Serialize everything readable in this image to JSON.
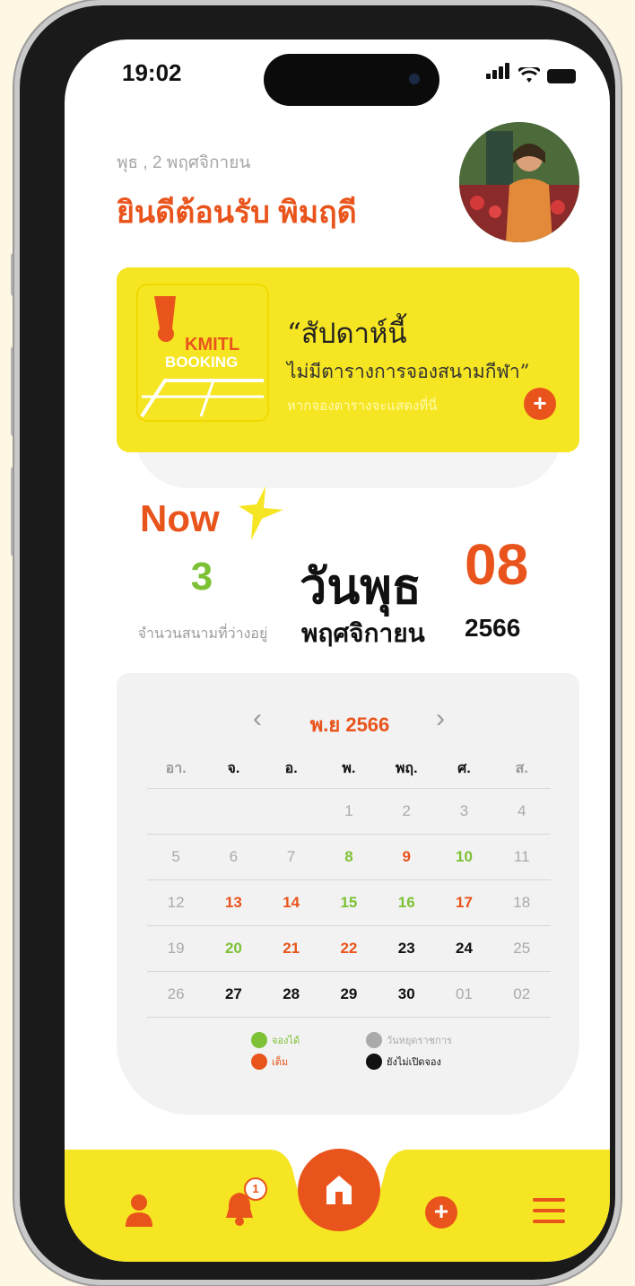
{
  "status": {
    "time": "19:02"
  },
  "header": {
    "date": "พุธ , 2 พฤศจิกายน",
    "welcome": "ยินดีต้อนรับ พิมฤดี"
  },
  "promo": {
    "logo_line1": "KMITL",
    "logo_line2": "BOOKING",
    "title": "“สัปดาห์นี้",
    "subtitle": "ไม่มีตารางการจองสนามกีฬา”",
    "hint": "หากจองตารางจะแสดงที่นี่",
    "add_icon": "+"
  },
  "now": {
    "label": "Now",
    "free_count": "3",
    "free_label": "จำนวนสนามที่ว่างอยู่",
    "day_name": "วันพุธ",
    "day_num": "08",
    "month_name": "พฤศจิกายน",
    "year": "2566"
  },
  "calendar": {
    "prev": "‹",
    "next": "›",
    "month_label": "พ.ย 2566",
    "weekdays": [
      {
        "label": "อา.",
        "color": "#9b9b9b"
      },
      {
        "label": "จ.",
        "color": "#111111"
      },
      {
        "label": "อ.",
        "color": "#111111"
      },
      {
        "label": "พ.",
        "color": "#111111"
      },
      {
        "label": "พฤ.",
        "color": "#111111"
      },
      {
        "label": "ศ.",
        "color": "#111111"
      },
      {
        "label": "ส.",
        "color": "#9b9b9b"
      }
    ],
    "weeks": [
      [
        {
          "d": "",
          "s": "g"
        },
        {
          "d": "",
          "s": "g"
        },
        {
          "d": "",
          "s": "g"
        },
        {
          "d": "1",
          "s": "g"
        },
        {
          "d": "2",
          "s": "g"
        },
        {
          "d": "3",
          "s": "g"
        },
        {
          "d": "4",
          "s": "g"
        }
      ],
      [
        {
          "d": "5",
          "s": "g"
        },
        {
          "d": "6",
          "s": "g"
        },
        {
          "d": "7",
          "s": "g"
        },
        {
          "d": "8",
          "s": "green"
        },
        {
          "d": "9",
          "s": "red"
        },
        {
          "d": "10",
          "s": "green"
        },
        {
          "d": "11",
          "s": "g"
        }
      ],
      [
        {
          "d": "12",
          "s": "g"
        },
        {
          "d": "13",
          "s": "red"
        },
        {
          "d": "14",
          "s": "red"
        },
        {
          "d": "15",
          "s": "green"
        },
        {
          "d": "16",
          "s": "green"
        },
        {
          "d": "17",
          "s": "red"
        },
        {
          "d": "18",
          "s": "g"
        }
      ],
      [
        {
          "d": "19",
          "s": "g"
        },
        {
          "d": "20",
          "s": "green"
        },
        {
          "d": "21",
          "s": "red"
        },
        {
          "d": "22",
          "s": "red"
        },
        {
          "d": "23",
          "s": "black"
        },
        {
          "d": "24",
          "s": "black"
        },
        {
          "d": "25",
          "s": "g"
        }
      ],
      [
        {
          "d": "26",
          "s": "g"
        },
        {
          "d": "27",
          "s": "black"
        },
        {
          "d": "28",
          "s": "black"
        },
        {
          "d": "29",
          "s": "black"
        },
        {
          "d": "30",
          "s": "black"
        },
        {
          "d": "01",
          "s": "g"
        },
        {
          "d": "02",
          "s": "g"
        }
      ]
    ],
    "legend": {
      "available": "จองได้",
      "full": "เต็ม",
      "holiday": "วันหยุดราชการ",
      "not_open": "ยังไม่เปิดจอง"
    }
  },
  "tabbar": {
    "badge": "1"
  },
  "colors": {
    "accent": "#e9541c",
    "yellow": "#f6e522",
    "green": "#7dc136",
    "red": "#e9541c",
    "gray": "#aaaaaa",
    "black": "#111111"
  },
  "icons": [
    "profile-icon",
    "bell-icon",
    "home-icon",
    "add-icon",
    "menu-icon",
    "chevron-left-icon",
    "chevron-right-icon",
    "badminton-shuttle-icon",
    "star-icon"
  ]
}
